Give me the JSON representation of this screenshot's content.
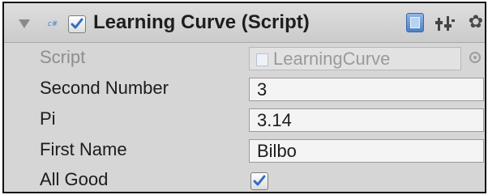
{
  "component": {
    "title": "Learning Curve (Script)",
    "enabled": true,
    "icons": {
      "foldout": "foldout-triangle-icon",
      "script_type": "csharp-script-icon",
      "help": "help-book-icon",
      "preset": "preset-sliders-icon",
      "settings": "gear-icon"
    },
    "cs_icon_text": "c#",
    "gear_glyph": "✿"
  },
  "fields": {
    "script": {
      "label": "Script",
      "value": "LearningCurve"
    },
    "second_number": {
      "label": "Second Number",
      "value": "3"
    },
    "pi": {
      "label": "Pi",
      "value": "3.14"
    },
    "first_name": {
      "label": "First Name",
      "value": "Bilbo"
    },
    "all_good": {
      "label": "All Good",
      "checked": true
    }
  },
  "colors": {
    "panel": "#d6d6d6",
    "check": "#2f6cc4",
    "text": "#1c1c1c",
    "disabled_text": "#8e8e8e"
  }
}
